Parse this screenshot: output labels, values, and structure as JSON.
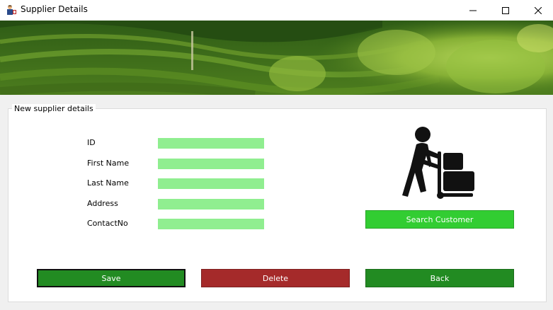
{
  "window": {
    "title": "Supplier Details",
    "icon": "person-app-icon"
  },
  "banner": {
    "image": "tea-plantation-photo",
    "colors": [
      "#2f5a14",
      "#6b9a2a",
      "#a3c84a"
    ]
  },
  "group": {
    "label": "New supplier details"
  },
  "fields": [
    {
      "label": "ID",
      "value": ""
    },
    {
      "label": "First Name",
      "value": ""
    },
    {
      "label": "Last Name",
      "value": ""
    },
    {
      "label": "Address",
      "value": ""
    },
    {
      "label": "ContactNo",
      "value": ""
    }
  ],
  "illustration": {
    "icon": "delivery-person-with-hand-truck-icon"
  },
  "buttons": {
    "search": "Search Customer",
    "save": "Save",
    "delete": "Delete",
    "back": "Back"
  },
  "colors": {
    "input_bg": "#90ee90",
    "search_bg": "#32cd32",
    "save_bg": "#228b22",
    "delete_bg": "#a52a2a",
    "back_bg": "#228b22"
  }
}
